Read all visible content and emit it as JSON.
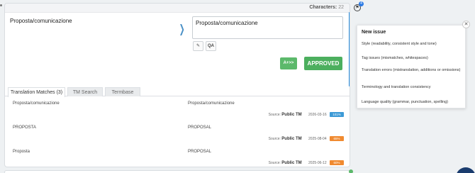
{
  "header": {
    "characters_label": "Characters:",
    "characters_count": "22"
  },
  "segment": {
    "source": "Proposta/comunicazione",
    "target": "Proposta/comunicazione"
  },
  "toolbar": {
    "qa_label": "QA",
    "auto_label": "A+>>",
    "approved_label": "APPROVED"
  },
  "tabs": [
    {
      "label": "Translation Matches (3)",
      "active": true
    },
    {
      "label": "TM Search",
      "active": false
    },
    {
      "label": "Termbase",
      "active": false
    }
  ],
  "matches": [
    {
      "source": "Proposta/comunicazione",
      "target": "Proposta/comunicazione",
      "origin_label": "Source:",
      "origin": "Public TM",
      "date": "2026-03-16",
      "pct": "101%",
      "color": "#3d9ad6"
    },
    {
      "source": "PROPOSTA",
      "target": "PROPOSAL",
      "origin_label": "Source:",
      "origin": "Public TM",
      "date": "2025-08-04",
      "pct": "65%",
      "color": "#f08a30"
    },
    {
      "source": "Proposta",
      "target": "PROPOSAL",
      "origin_label": "Source:",
      "origin": "Public TM",
      "date": "2025-06-12",
      "pct": "60%",
      "color": "#f08a30"
    }
  ],
  "issue_badge_count": "4",
  "issue_menu": {
    "title": "New issue",
    "items": [
      "Style (readability, consistent style and tone)",
      "Tag issues (mismatches, whitespaces)",
      "Translation errors (mistranslation, additions or omissions)",
      "Terminology and translation consistency",
      "Language quality (grammar, punctuation, spelling)"
    ]
  },
  "colors": {
    "accent": "#2c8fe0",
    "approved": "#4caf5e"
  },
  "icons": {
    "arrow": "chevron-right-icon",
    "edit": "pencil-icon",
    "issue": "issue-icon",
    "close": "close-icon"
  }
}
